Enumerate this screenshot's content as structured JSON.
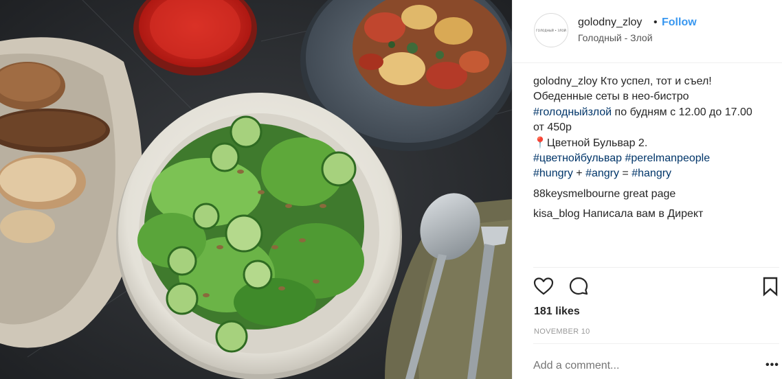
{
  "post": {
    "image_alt": "Salad, bread and pasta on a dark table",
    "username": "golodny_zloy",
    "dot": "•",
    "follow_label": "Follow",
    "location": "Голодный - Злой",
    "avatar_text": "ГОЛОДНЫЙ • ЗЛОЙ"
  },
  "caption": {
    "user": "golodny_zloy",
    "lines": [
      "Кто успел, тот и съел!",
      "Обеденные сеты в нео-бистро",
      "#голодныйзлой",
      " по будням с 12.00 до 17.00",
      "от 450р",
      "📍Цветной Бульвар 2.",
      "#цветнойбульвар",
      "#perelmanpeople",
      "#hungry",
      " + ",
      "#angry",
      " = ",
      "#hangry"
    ]
  },
  "comments": [
    {
      "user": "88keysmelbourne",
      "text": "great page"
    },
    {
      "user": "kisa_blog",
      "text": "Написала вам в Директ"
    }
  ],
  "actions": {
    "like_icon": "heart-icon",
    "comment_icon": "comment-bubble-icon",
    "save_icon": "bookmark-icon"
  },
  "likes": "181 likes",
  "date": "NOVEMBER 10",
  "add_comment_placeholder": "Add a comment...",
  "more_label": "•••",
  "colors": {
    "follow": "#3897f0",
    "hashtag": "#003569",
    "text": "#262626",
    "muted": "#999999"
  }
}
